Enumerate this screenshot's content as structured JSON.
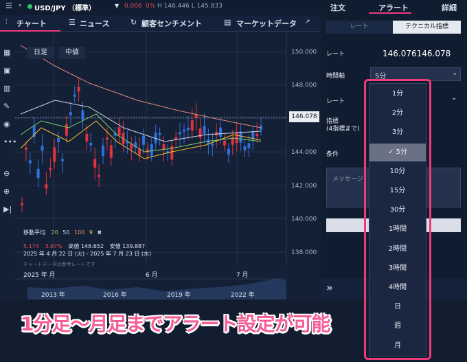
{
  "topbar": {
    "symbol": "USD/JPY （標準）",
    "change": "0.006",
    "pct": "0%",
    "hl": "H 146.446  L 145.833"
  },
  "right_tabs": [
    "注文",
    "アラート",
    "詳細"
  ],
  "tabs": [
    "チャート",
    "ニュース",
    "顧客センチメント",
    "マーケットデータ"
  ],
  "chart": {
    "toolbar": [
      "日足",
      "中値"
    ],
    "price_ticks": [
      "150.000",
      "148.000",
      "146.000",
      "144.000",
      "142.000",
      "140.000",
      "138.000"
    ],
    "last_price": "146.078",
    "legend": {
      "title": "移動平均",
      "ma": [
        "20",
        "50",
        "100",
        "9"
      ]
    },
    "stats": {
      "chg": "5.174",
      "pct": "3.67%",
      "high": "高値 148.652",
      "low": "安値 139.887"
    },
    "range": "2025 年 4 月 22 日 (火) - 2025 年 7 月 23 日 (水)",
    "note": "チャートデータは参考レートです",
    "x_labels": [
      "2025 年  月",
      "6 月",
      "7 月"
    ],
    "nav_labels": [
      "2013 年",
      "2016 年",
      "2019 年",
      "2022 年"
    ]
  },
  "alert": {
    "tabs": [
      "レート",
      "テクニカル指標"
    ],
    "rate_label": "レート",
    "rate_value": "146.076146.078",
    "time_label": "時間軸",
    "time_value": "5分",
    "rate2": "レート",
    "indicator": "指標\n(4指標まで)",
    "cond": "条件",
    "message": "メッセージ"
  },
  "dropdown": [
    "1分",
    "2分",
    "3分",
    "5分",
    "10分",
    "15分",
    "30分",
    "1時間",
    "2時間",
    "3時間",
    "4時間",
    "日",
    "週",
    "月"
  ],
  "dropdown_selected": "5分",
  "banner": "1分足〜月足までアラート設定が可能",
  "colors": {
    "up": "#2f6fe0",
    "down": "#e0333b",
    "accent": "#f0397a",
    "banner": "#f45d95"
  }
}
